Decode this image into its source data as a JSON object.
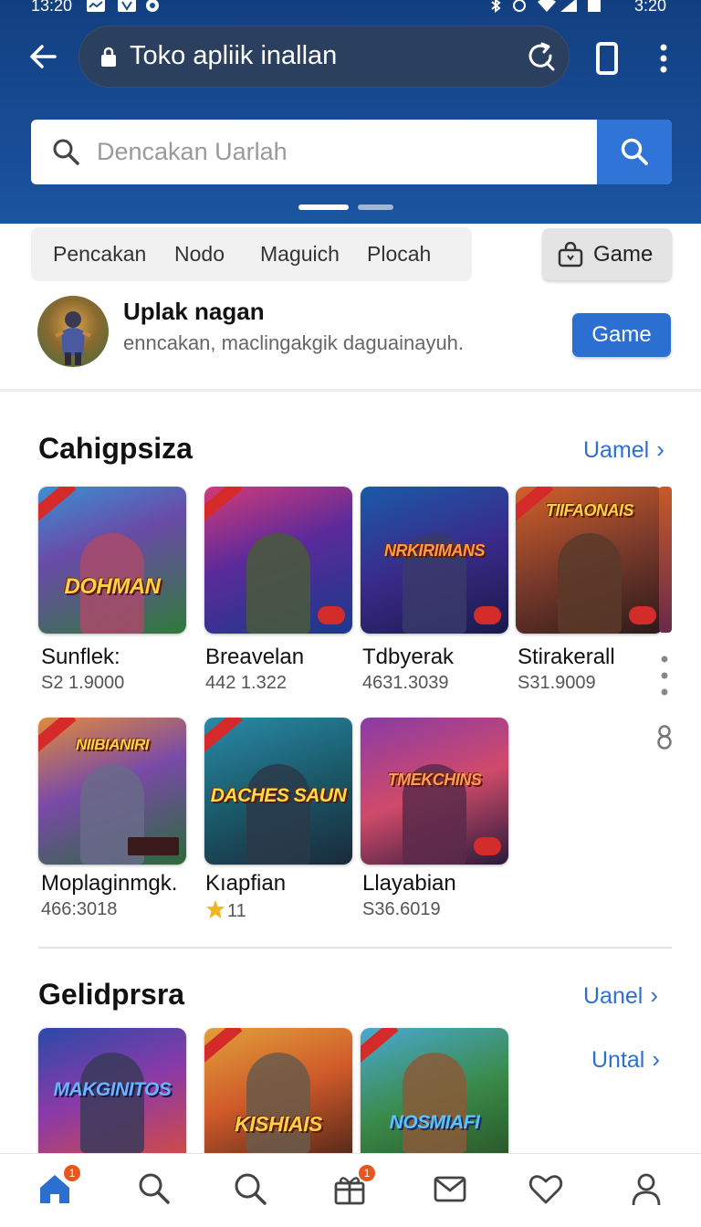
{
  "status_bar": {
    "time": "13:20",
    "right_time": "3:20"
  },
  "browser": {
    "url": "Toko apliik inallan"
  },
  "search": {
    "placeholder": "Dencakan Uarlah"
  },
  "filters": {
    "chips": [
      "Pencakan",
      "Nodo",
      "Maguich",
      "Plocah"
    ],
    "toggle_label": "Game"
  },
  "profile": {
    "title": "Uplak nagan",
    "subtitle": "enncakan, maclingakgik daguainayuh.",
    "button_label": "Game"
  },
  "section1": {
    "title": "Cahigpsiza",
    "see_more": "Uamel",
    "apps": [
      {
        "name": "Sunflek:",
        "meta": "S2 1.9000",
        "logo": "DOHMAN"
      },
      {
        "name": "Breavelan",
        "meta": "442 1.322",
        "logo": ""
      },
      {
        "name": "Tdbyerak",
        "meta": "4631.3039",
        "logo": "NRKIRIMANS"
      },
      {
        "name": "Stirakerall",
        "meta": "S31.9009",
        "logo": "TIIFAONAIS"
      },
      {
        "name": "Moplaginmgk.",
        "meta": "466:3018",
        "logo": "NIIBIANIRI"
      },
      {
        "name": "Kıapfian",
        "meta": "11",
        "logo": "DACHES SAUN"
      },
      {
        "name": "Llayabian",
        "meta": "S36.6019",
        "logo": "TMEKCHINS"
      }
    ]
  },
  "section2": {
    "title": "Gelidprsra",
    "see_more": "Uanel",
    "see_more_2": "Untal",
    "apps": [
      {
        "logo": "MAKGINITOS"
      },
      {
        "logo": "KISHIAIS"
      },
      {
        "logo": "NOSMIAFI"
      }
    ]
  },
  "bottom_nav": {
    "items": [
      "home-icon",
      "search-icon",
      "search-icon",
      "gift-icon",
      "mail-icon",
      "heart-icon",
      "profile-icon"
    ],
    "badges": {
      "home": "1",
      "gift": "1"
    }
  },
  "colors": {
    "header_blue": "#174b93",
    "accent": "#2f6fcf",
    "button_blue": "#2b6fd0",
    "badge_orange": "#e7561f"
  }
}
